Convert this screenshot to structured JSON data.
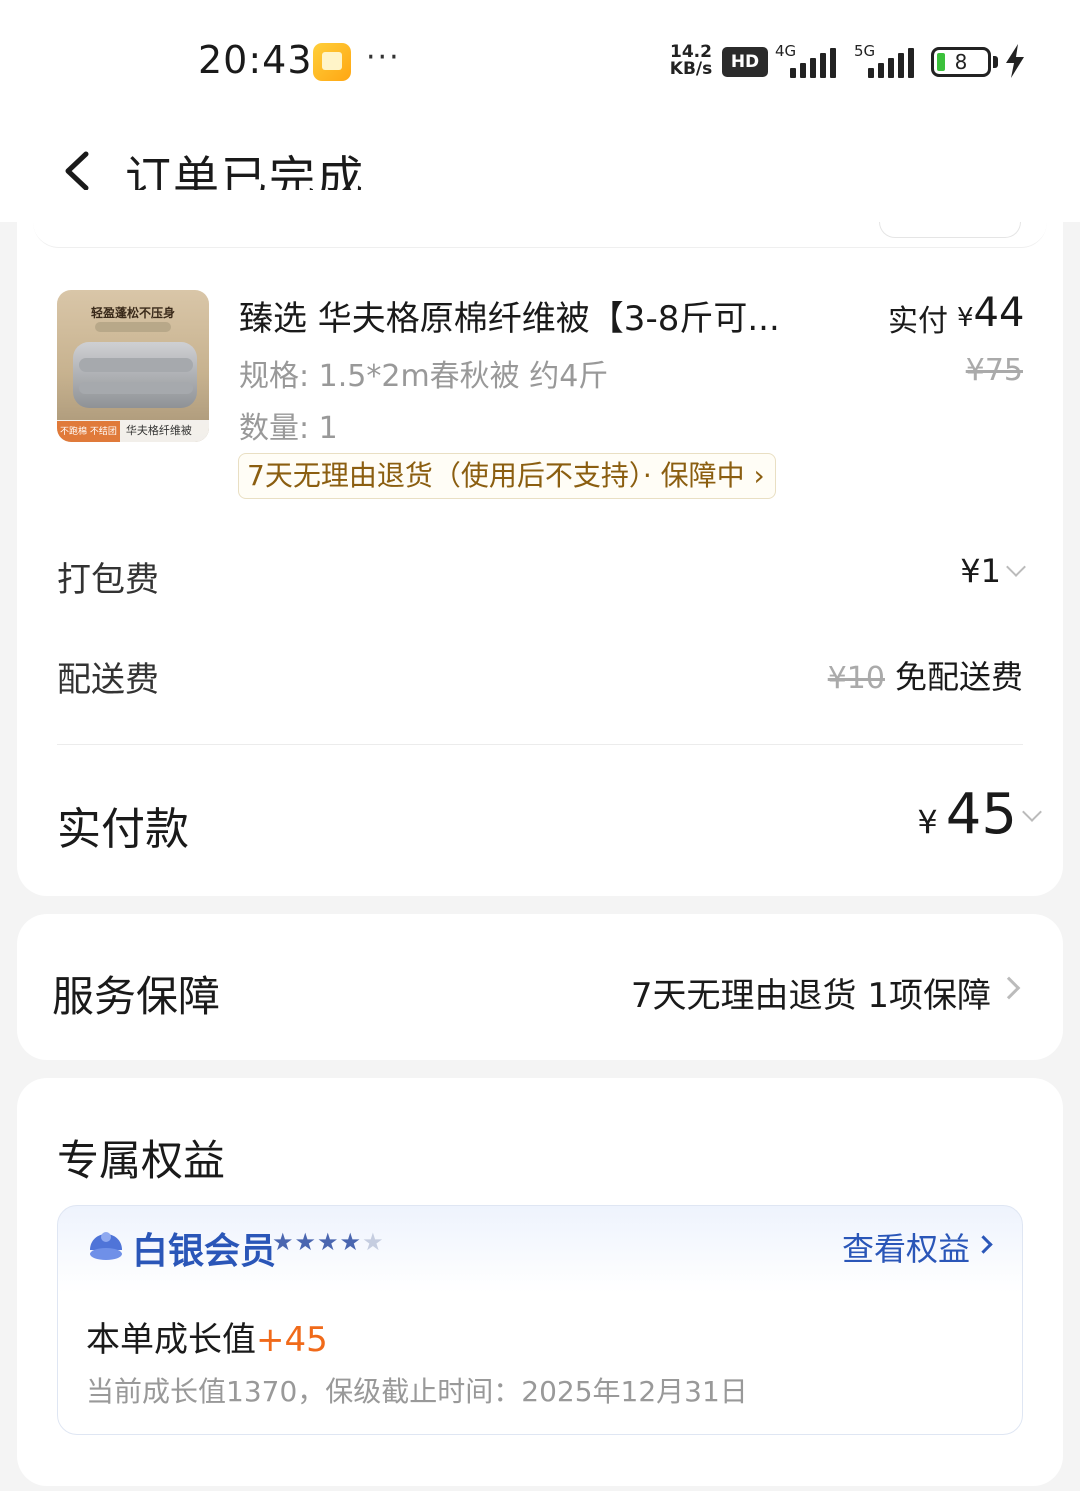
{
  "status_bar": {
    "time": "20:43",
    "more": "···",
    "speed_value": "14.2",
    "speed_unit": "KB/s",
    "hd_label": "HD",
    "net1": "4G",
    "net2": "5G",
    "battery": "8"
  },
  "header": {
    "title": "订单已完成"
  },
  "product": {
    "image_top_text": "轻盈蓬松不压身",
    "image_bottom_tag": "不跑棉 不结团",
    "image_bottom_text": "华夫格纤维被",
    "name": "臻选 华夫格原棉纤维被【3-8斤可...",
    "spec": "规格: 1.5*2m春秋被 约4斤",
    "quantity": "数量: 1",
    "paid_label": "实付",
    "paid_currency": "¥",
    "paid_amount": "44",
    "original_price": "¥75",
    "return_policy": "7天无理由退货（使用后不支持）· 保障中 ›"
  },
  "fees": {
    "packing_label": "打包费",
    "packing_value": "¥1",
    "delivery_label": "配送费",
    "delivery_original": "¥10",
    "delivery_value": "免配送费"
  },
  "total": {
    "label": "实付款",
    "currency": "¥",
    "amount": "45"
  },
  "service": {
    "label": "服务保障",
    "value": "7天无理由退货 1项保障"
  },
  "benefit": {
    "title": "专属权益",
    "tier": "白银会员",
    "stars_on": "★★★★",
    "stars_off": "★",
    "view_label": "查看权益",
    "growth_label": "本单成长值",
    "growth_value": "+45",
    "growth_note": "当前成长值1370，保级截止时间：2025年12月31日"
  }
}
